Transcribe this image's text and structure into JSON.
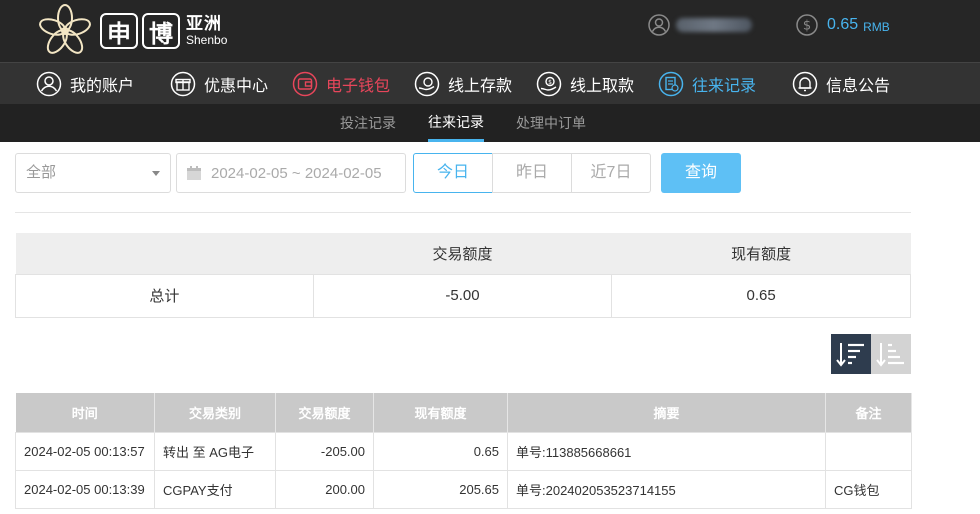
{
  "header": {
    "logo_box1": "申",
    "logo_box2": "博",
    "logo_cn": "亚洲",
    "logo_en": "Shenbo",
    "balance_value": "0.65",
    "balance_unit": "RMB",
    "accent_color": "#48b4ee",
    "alert_color": "#e8465b"
  },
  "nav": {
    "items": [
      {
        "label": "我的账户",
        "icon": "user-icon"
      },
      {
        "label": "优惠中心",
        "icon": "gift-icon"
      },
      {
        "label": "电子钱包",
        "icon": "wallet-icon"
      },
      {
        "label": "线上存款",
        "icon": "deposit-icon"
      },
      {
        "label": "线上取款",
        "icon": "withdraw-icon"
      },
      {
        "label": "往来记录",
        "icon": "records-icon"
      },
      {
        "label": "信息公告",
        "icon": "bell-icon"
      }
    ]
  },
  "subnav": {
    "tabs": [
      {
        "label": "投注记录"
      },
      {
        "label": "往来记录"
      },
      {
        "label": "处理中订单"
      }
    ]
  },
  "filters": {
    "type_select": "全部",
    "date_range": "2024-02-05 ~ 2024-02-05",
    "quick": [
      "今日",
      "昨日",
      "近7日"
    ],
    "query_label": "查询"
  },
  "summary": {
    "headers": [
      "",
      "交易额度",
      "现有额度"
    ],
    "row": [
      "总计",
      "-5.00",
      "0.65"
    ]
  },
  "records": {
    "headers": [
      "时间",
      "交易类别",
      "交易额度",
      "现有额度",
      "摘要",
      "备注"
    ],
    "rows": [
      [
        "2024-02-05 00:13:57",
        "转出 至 AG电子",
        "-205.00",
        "0.65",
        "单号:113885668661",
        ""
      ],
      [
        "2024-02-05 00:13:39",
        "CGPAY支付",
        "200.00",
        "205.65",
        "单号:202402053523714155",
        "CG钱包"
      ]
    ]
  }
}
